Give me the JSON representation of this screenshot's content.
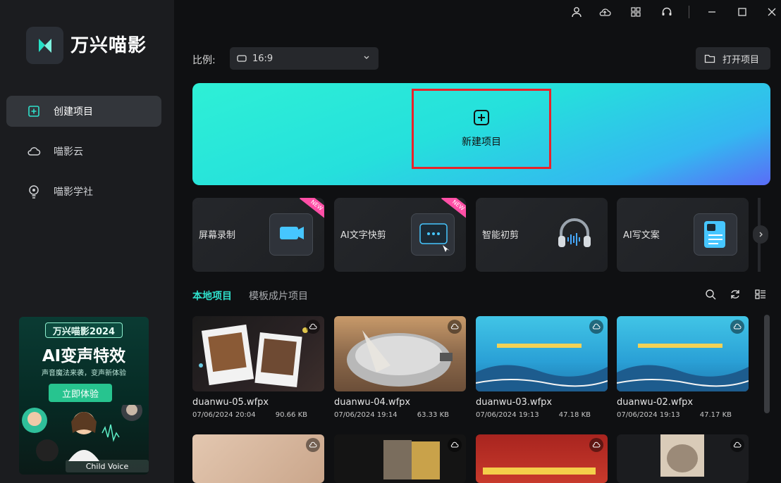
{
  "app": {
    "title": "万兴喵影"
  },
  "sidebar": {
    "items": [
      {
        "label": "创建项目",
        "icon": "add-file-icon",
        "active": true
      },
      {
        "label": "喵影云",
        "icon": "cloud-icon",
        "active": false
      },
      {
        "label": "喵影学社",
        "icon": "lightbulb-icon",
        "active": false
      }
    ]
  },
  "promo": {
    "tag": "万兴喵影2024",
    "title": "AI变声特效",
    "subtitle": "声音魔法来袭，变声新体验",
    "button": "立即体验",
    "voice_label": "Child Voice"
  },
  "titlebar": {
    "icons": [
      "user-icon",
      "cloud-sync-icon",
      "apps-grid-icon",
      "headset-icon",
      "minimize-icon",
      "maximize-icon",
      "close-icon"
    ]
  },
  "toolbar": {
    "ratio_label": "比例:",
    "ratio_value": "16:9",
    "open_project": "打开项目"
  },
  "banner": {
    "new_project": "新建项目"
  },
  "features": [
    {
      "label": "屏幕录制",
      "badge": "NEW"
    },
    {
      "label": "AI文字快剪",
      "badge": "NEW"
    },
    {
      "label": "智能初剪",
      "badge": ""
    },
    {
      "label": "AI写文案",
      "badge": ""
    }
  ],
  "tabs": [
    {
      "label": "本地项目",
      "active": true
    },
    {
      "label": "模板成片项目",
      "active": false
    }
  ],
  "projects": [
    {
      "name": "duanwu-05.wfpx",
      "date": "07/06/2024 20:04",
      "size": "90.66 KB"
    },
    {
      "name": "duanwu-04.wfpx",
      "date": "07/06/2024 19:14",
      "size": "63.33 KB"
    },
    {
      "name": "duanwu-03.wfpx",
      "date": "07/06/2024 19:13",
      "size": "47.18 KB"
    },
    {
      "name": "duanwu-02.wfpx",
      "date": "07/06/2024 19:13",
      "size": "47.17 KB"
    },
    {
      "name": "",
      "date": "",
      "size": ""
    },
    {
      "name": "",
      "date": "",
      "size": ""
    },
    {
      "name": "",
      "date": "",
      "size": ""
    },
    {
      "name": "",
      "date": "",
      "size": ""
    }
  ],
  "colors": {
    "accent": "#2fe0cb",
    "highlight_border": "#e8232a",
    "sidebar_bg": "#1b1c1f",
    "main_bg": "#0f1012"
  }
}
